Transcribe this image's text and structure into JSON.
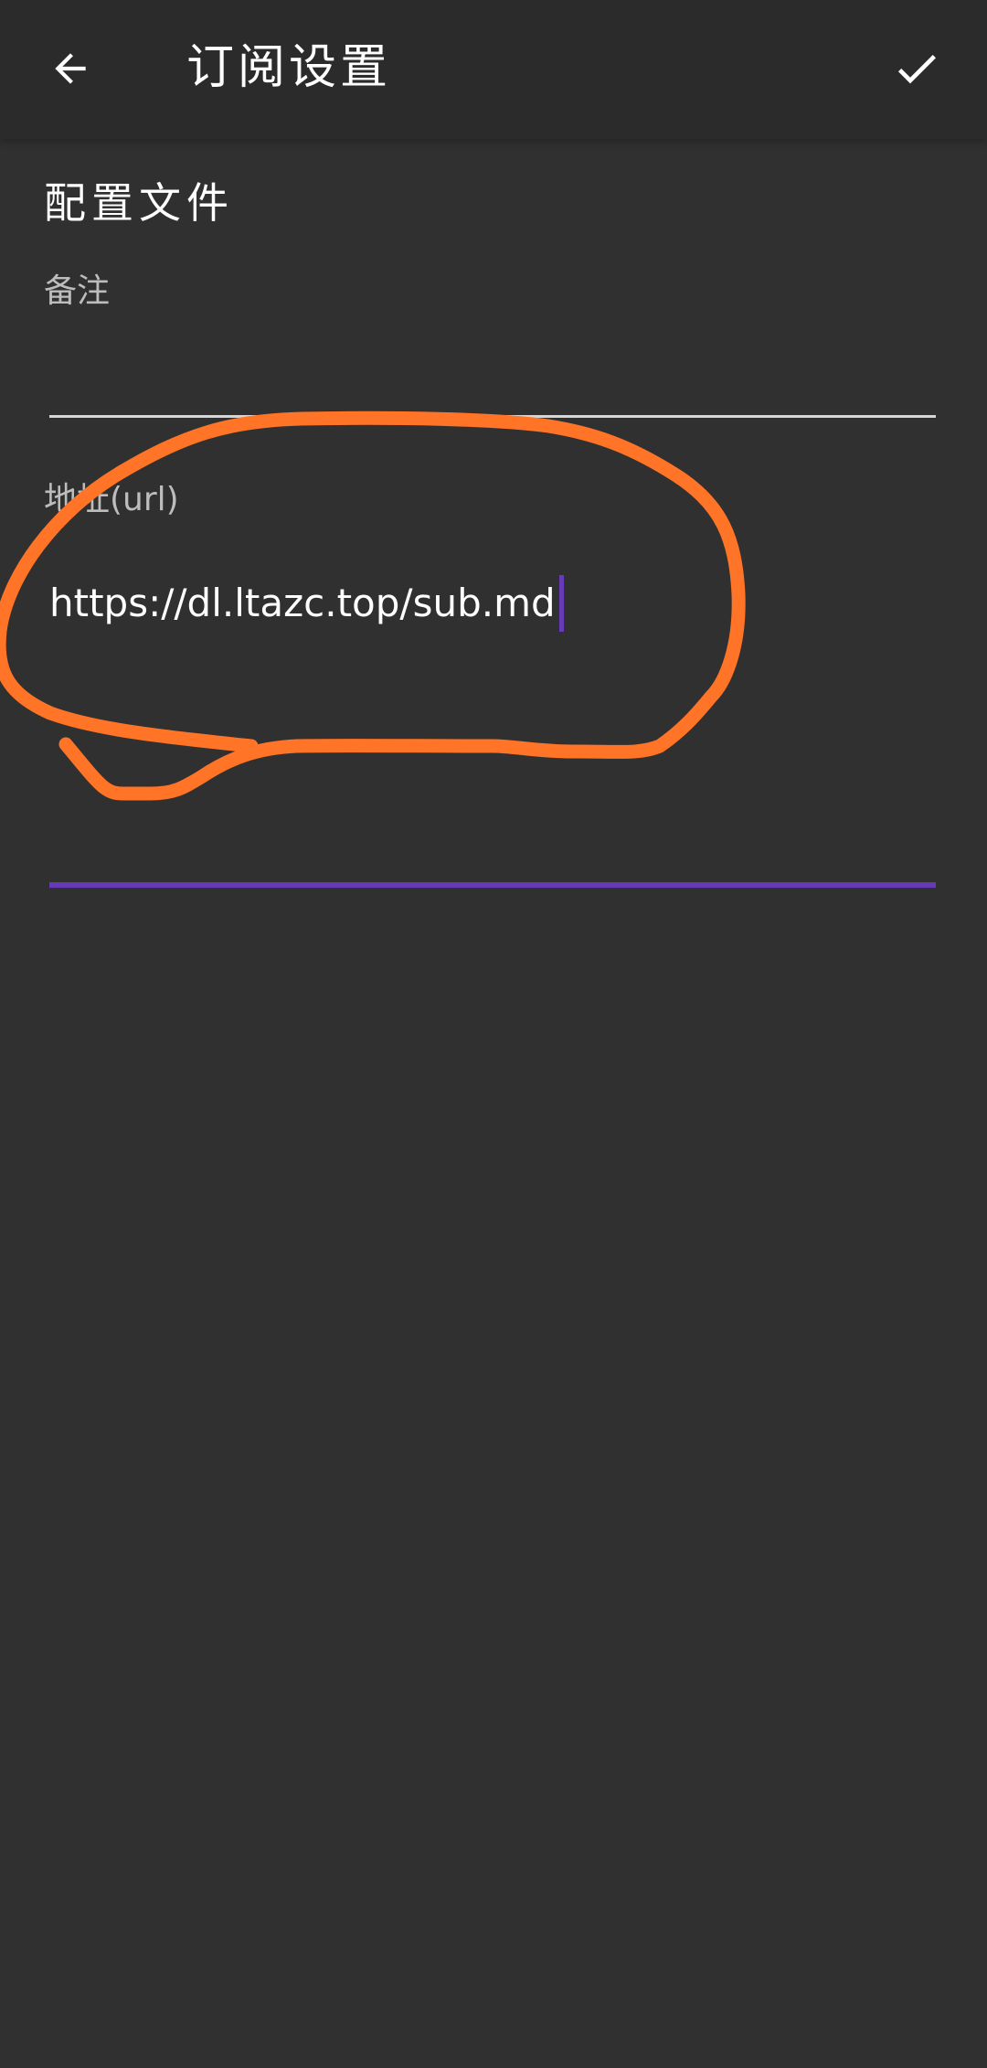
{
  "toolbar": {
    "title": "订阅设置",
    "back_icon": "arrow-back-icon",
    "save_icon": "check-icon"
  },
  "section": {
    "title": "配置文件"
  },
  "fields": {
    "remark": {
      "label": "备注",
      "value": ""
    },
    "url": {
      "label": "地址(url)",
      "value": "https://dl.ltazc.top/sub.md"
    }
  },
  "colors": {
    "background": "#303030",
    "toolbar": "#2b2b2b",
    "accent": "#673ab7",
    "annotation": "#ff7426",
    "label": "#bdbdbd"
  }
}
